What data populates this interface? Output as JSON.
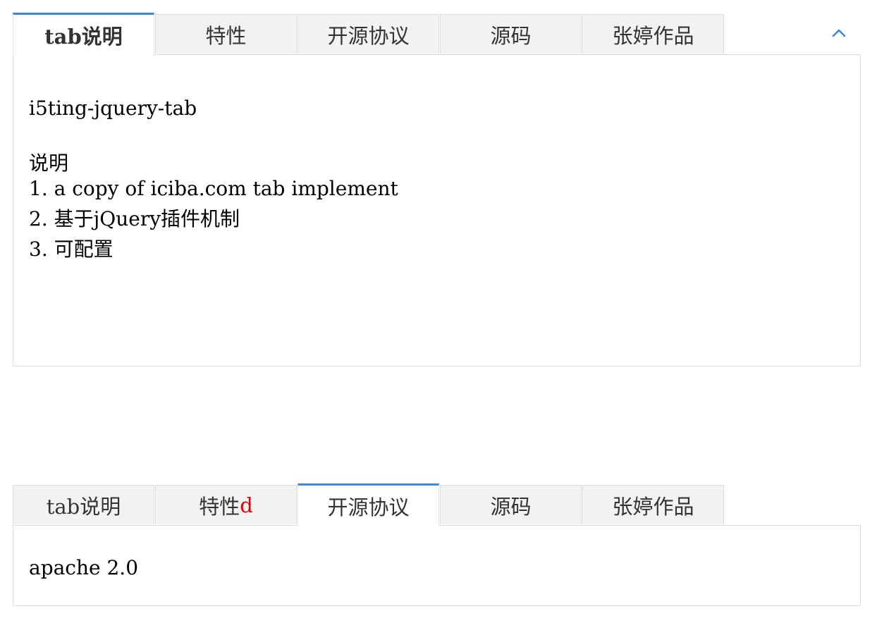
{
  "widgets": [
    {
      "tabs": [
        {
          "label": "tab说明",
          "suffix": ""
        },
        {
          "label": "特性",
          "suffix": ""
        },
        {
          "label": "开源协议",
          "suffix": ""
        },
        {
          "label": "源码",
          "suffix": ""
        },
        {
          "label": "张婷作品",
          "suffix": ""
        }
      ],
      "active_tab": 0,
      "collapse_icon": "chevron-up-icon",
      "content": {
        "title": "i5ting-jquery-tab",
        "heading": "说明",
        "items": [
          "1. a copy of iciba.com tab implement",
          "2. 基于jQuery插件机制",
          "3. 可配置"
        ]
      }
    },
    {
      "tabs": [
        {
          "label": "tab说明",
          "suffix": ""
        },
        {
          "label": "特性",
          "suffix": "d"
        },
        {
          "label": "开源协议",
          "suffix": ""
        },
        {
          "label": "源码",
          "suffix": ""
        },
        {
          "label": "张婷作品",
          "suffix": ""
        }
      ],
      "active_tab": 2,
      "content": {
        "text": "apache 2.0"
      }
    }
  ],
  "colors": {
    "accent": "#3c86e0",
    "tab_background": "#f2f2f2",
    "border": "#dddddd",
    "highlight_text": "#e40000"
  }
}
